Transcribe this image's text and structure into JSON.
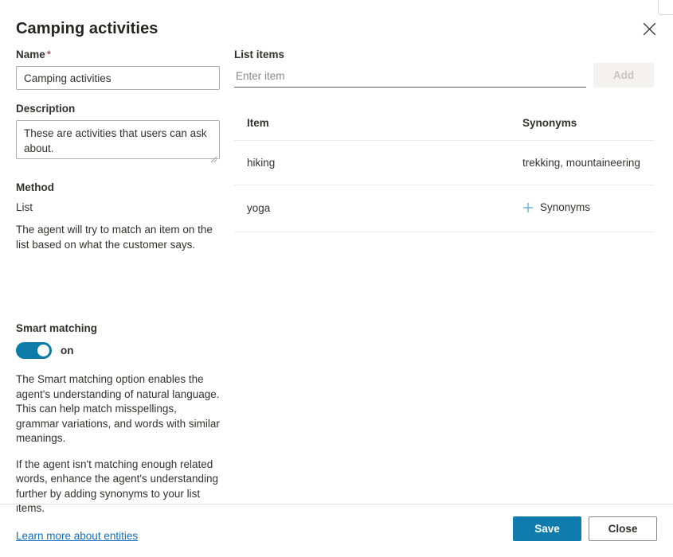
{
  "dialog": {
    "title": "Camping activities",
    "close_icon": "close-icon"
  },
  "left": {
    "name": {
      "label": "Name",
      "required_marker": "*",
      "value": "Camping activities"
    },
    "description": {
      "label": "Description",
      "value": "These are activities that users can ask about."
    },
    "method": {
      "label": "Method",
      "value": "List",
      "help": "The agent will try to match an item on the list based on what the customer says."
    },
    "smart_matching": {
      "label": "Smart matching",
      "state": "on",
      "paragraph_1": "The Smart matching option enables the agent's understanding of natural language. This can help match misspellings, grammar variations, and words with similar meanings.",
      "paragraph_2": "If the agent isn't matching enough related words, enhance the agent's understanding further by adding synonyms to your list items.",
      "link_text": "Learn more about entities"
    }
  },
  "right": {
    "list_items": {
      "label": "List items",
      "input_value": "",
      "input_placeholder": "Enter item",
      "add_label": "Add"
    },
    "table": {
      "headers": {
        "item": "Item",
        "synonyms": "Synonyms"
      },
      "rows": [
        {
          "item": "hiking",
          "synonyms": "trekking, mountaineering",
          "has_synonyms": true
        },
        {
          "item": "yoga",
          "synonyms": "",
          "has_synonyms": false,
          "add_label": "Synonyms"
        }
      ]
    }
  },
  "footer": {
    "save_label": "Save",
    "close_label": "Close"
  },
  "colors": {
    "accent": "#0f7cad",
    "toggle_on": "#0d7ba8",
    "link": "#0f6cbd",
    "required": "#a4262c",
    "plus": "#6aaed6",
    "divider": "#edebe9"
  }
}
